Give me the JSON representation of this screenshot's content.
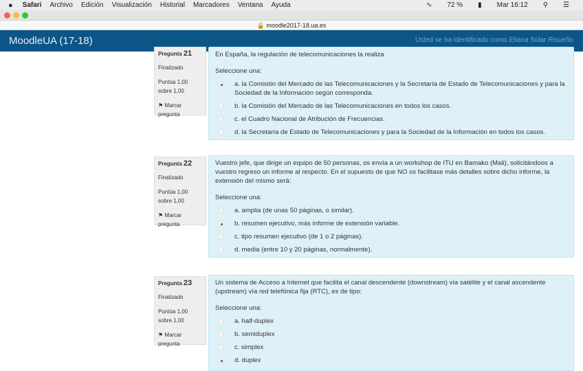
{
  "menubar": {
    "apple": "",
    "app": "Safari",
    "items": [
      "Archivo",
      "Edición",
      "Visualización",
      "Historial",
      "Marcadores",
      "Ventana",
      "Ayuda"
    ],
    "battery": "72 %",
    "clock": "Mar 16:12"
  },
  "url": "moodle2017-18.ua.es",
  "navbar": {
    "brand": "MoodleUA (17-18)",
    "login": "Usted se ha identificado como Eliana Solar Risueño"
  },
  "questions": [
    {
      "label": "Pregunta",
      "num": "21",
      "state": "Finalizado",
      "score": "Puntúa 1,00 sobre 1,00",
      "flag": "Marcar pregunta",
      "text": "En España, la regulación de telecomunicaciones la realiza",
      "select": "Seleccione una:",
      "options": [
        "a. la Comisión del Mercado de las Telecomunicaciones y la Secretaría de Estado de Telecomunicaciones y para la Sociedad de la Información según corresponda.",
        "b. la Comisión del Mercado de las Telecomunicaciones en todos los casos.",
        "c. el Cuadro Nacional de Atribución de Frecuencias.",
        "d. la Secretaría de Estado de Telecomunicaciones y para la Sociedad de la Información en todos los casos."
      ],
      "selected": 0
    },
    {
      "label": "Pregunta",
      "num": "22",
      "state": "Finalizado",
      "score": "Puntúa 1,00 sobre 1,00",
      "flag": "Marcar pregunta",
      "text": "Vuestro jefe, que dirige un equipo de 50 personas, os envía a un workshop de ITU en Bamako (Mali), solicitándoos a vuestro regreso un informe al respecto. En el supuesto de que NO os facilitase más detalles sobre dicho informe, la extensión del mismo será:",
      "select": "Seleccione una:",
      "options": [
        "a. amplia (de unas 50 páginas, o similar).",
        "b. resumen ejecutivo, más informe de extensión variable.",
        "c. tipo resumen ejecutivo (de 1 o 2 páginas).",
        "d. media (entre 10 y 20 páginas, normalmente)."
      ],
      "selected": 1
    },
    {
      "label": "Pregunta",
      "num": "23",
      "state": "Finalizado",
      "score": "Puntúa 1,00 sobre 1,00",
      "flag": "Marcar pregunta",
      "text": "Un sistema de Acceso a Internet que facilita el canal descendente (downstream) vía satélite y el canal ascendente (upstream) vía red telefónica fija (RTC), es de tipo:",
      "select": "Seleccione una:",
      "options": [
        "a. half-duplex",
        "b. semiduplex",
        "c. simplex",
        "d. duplex"
      ],
      "selected": 3
    }
  ]
}
